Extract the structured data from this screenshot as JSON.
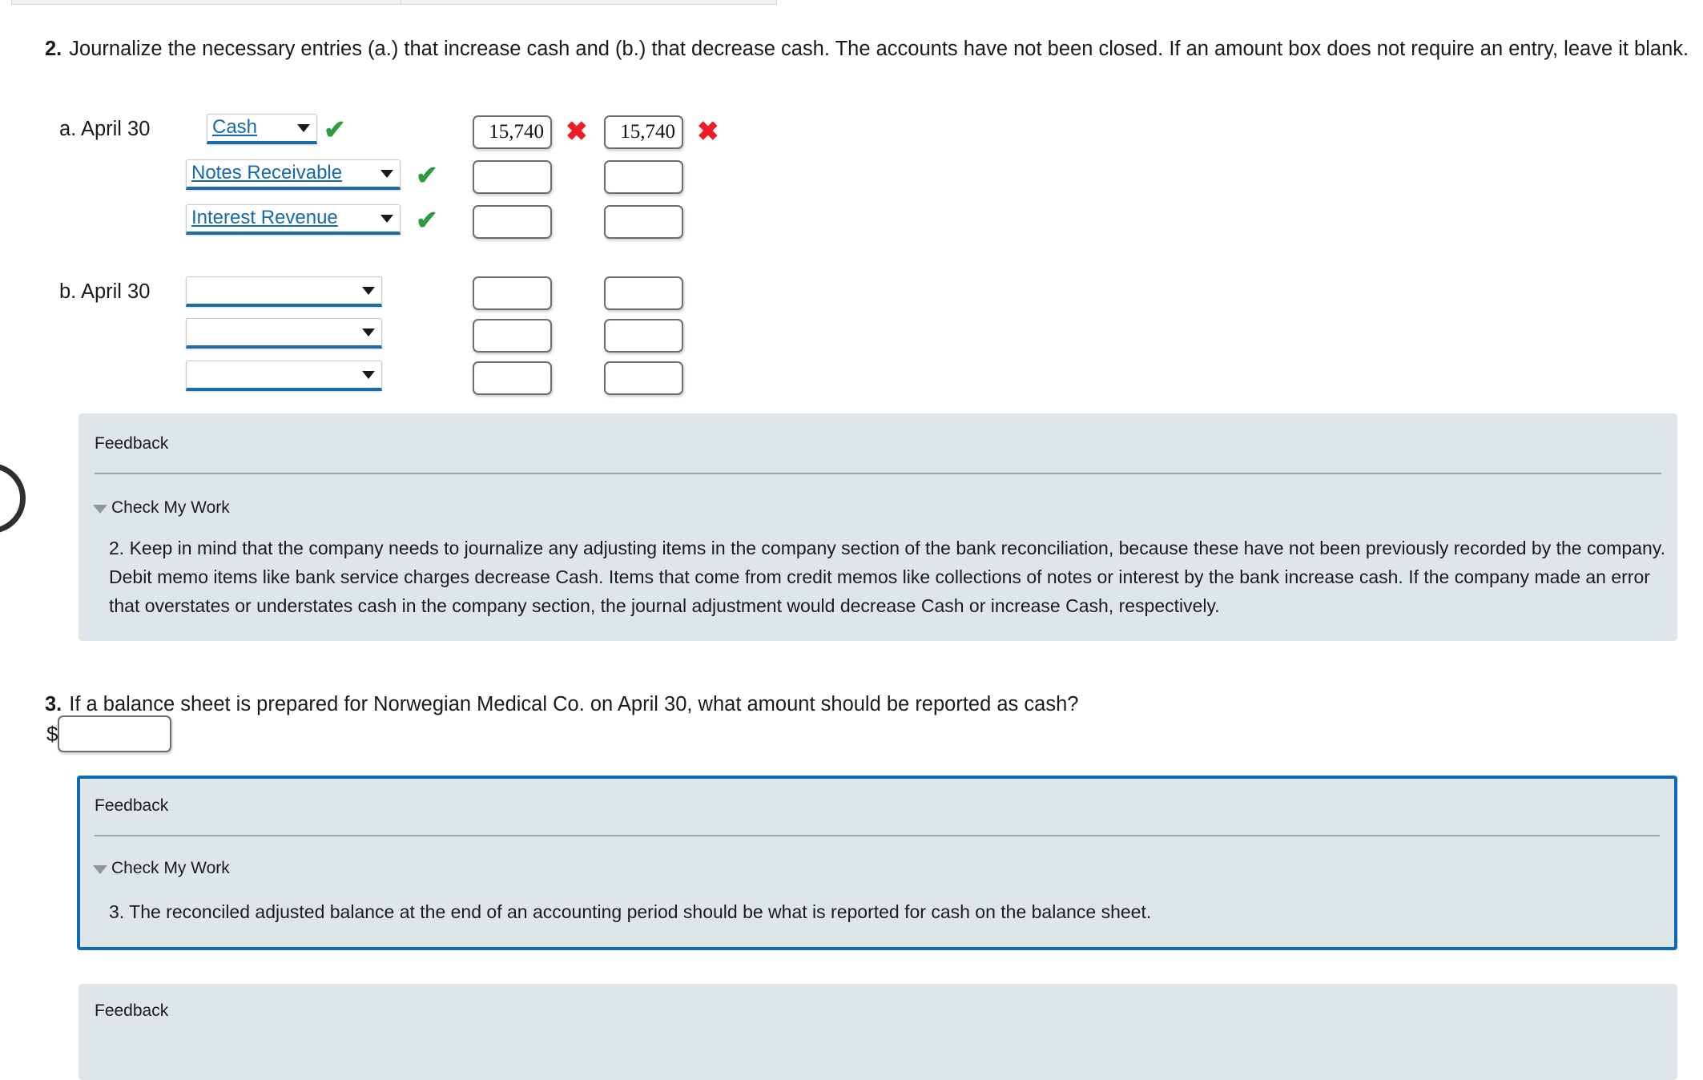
{
  "top_tabs": [
    {
      "name": "tab-strip-left"
    },
    {
      "name": "tab-strip-right"
    }
  ],
  "question2": {
    "number": "2.",
    "text": "Journalize the necessary entries (a.) that increase cash and (b.) that decrease cash. The accounts have not been closed. If an amount box does not require an entry, leave it blank.",
    "entries": [
      {
        "label": "a. April 30",
        "rows": [
          {
            "account": "Cash",
            "account_status": "correct",
            "debit": "15,740",
            "debit_status": "incorrect",
            "credit": "15,740",
            "credit_status": "incorrect"
          },
          {
            "account": "Notes Receivable",
            "account_status": "correct",
            "debit": "",
            "debit_status": "none",
            "credit": "",
            "credit_status": "none"
          },
          {
            "account": "Interest Revenue",
            "account_status": "correct",
            "debit": "",
            "debit_status": "none",
            "credit": "",
            "credit_status": "none"
          }
        ]
      },
      {
        "label": "b. April 30",
        "rows": [
          {
            "account": "",
            "account_status": "none",
            "debit": "",
            "debit_status": "none",
            "credit": "",
            "credit_status": "none"
          },
          {
            "account": "",
            "account_status": "none",
            "debit": "",
            "debit_status": "none",
            "credit": "",
            "credit_status": "none"
          },
          {
            "account": "",
            "account_status": "none",
            "debit": "",
            "debit_status": "none",
            "credit": "",
            "credit_status": "none"
          }
        ]
      }
    ],
    "feedback": {
      "title": "Feedback",
      "toggle_label": "Check My Work",
      "body": "2. Keep in mind that the company needs to journalize any adjusting items in the company section of the bank reconciliation, because these have not been previously recorded by the company. Debit memo items like bank service charges decrease Cash. Items that come from credit memos like collections of notes or interest by the bank increase cash. If the company made an error that overstates or understates cash in the company section, the journal adjustment would decrease Cash or increase Cash, respectively."
    }
  },
  "question3": {
    "number": "3.",
    "text": "If a balance sheet is prepared for Norwegian Medical Co. on April 30, what amount should be reported as cash?",
    "currency_symbol": "$",
    "answer_value": "",
    "feedback": {
      "title": "Feedback",
      "toggle_label": "Check My Work",
      "body": "3. The reconciled adjusted balance at the end of an accounting period should be what is reported for cash on the balance sheet."
    }
  },
  "bottom_feedback": {
    "title": "Feedback"
  },
  "marks": {
    "correct_glyph": "✔",
    "incorrect_glyph": "✖"
  },
  "colors": {
    "accent_blue": "#1b6ca8",
    "link_blue": "#1667b1",
    "correct_green": "#2e9b3f",
    "incorrect_red": "#ee1c25",
    "feedback_bg": "#dfe6e8",
    "feedback_border": "#0e6ab4"
  }
}
